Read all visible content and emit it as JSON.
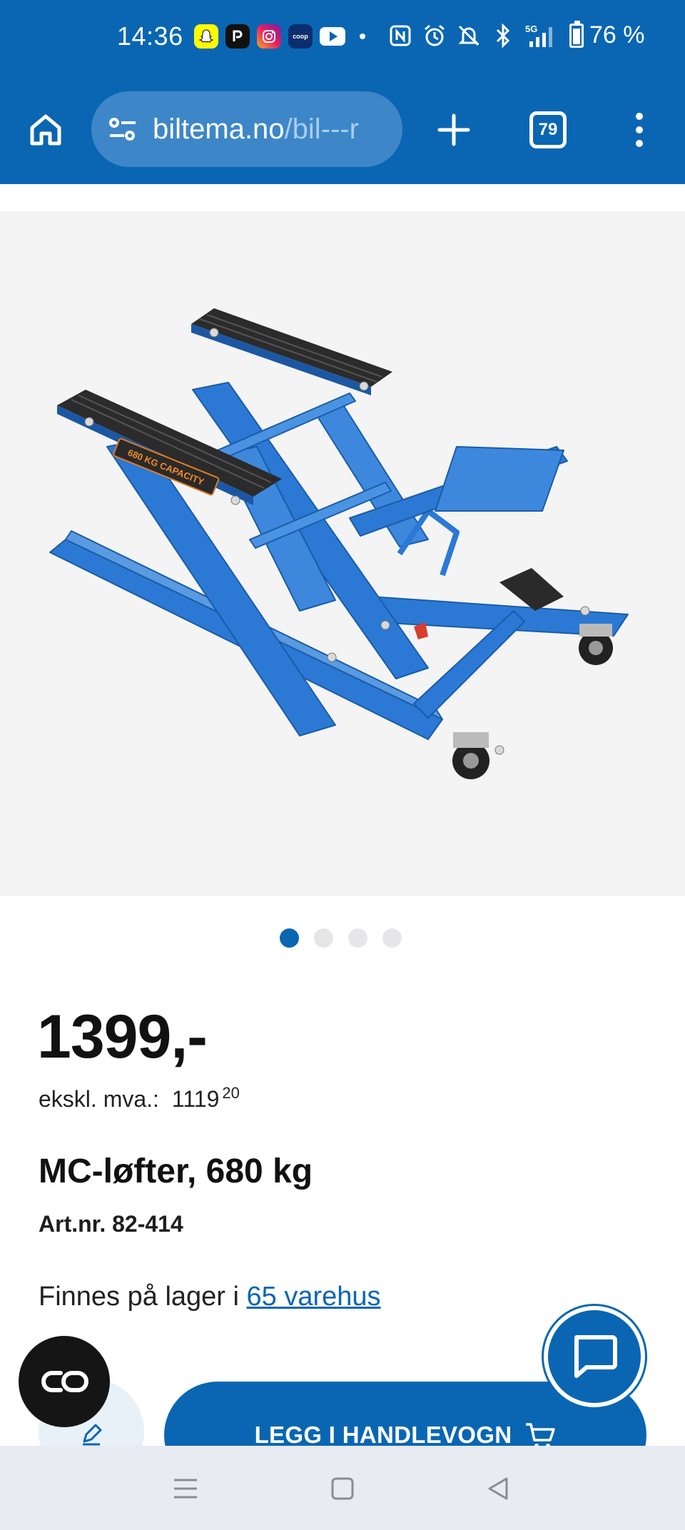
{
  "status_bar": {
    "time": "14:36",
    "network": "5G",
    "battery": "76 %",
    "battery_level": 0.76,
    "app_icons": [
      "snapchat-icon",
      "p-app-icon",
      "instagram-icon",
      "coop-icon",
      "youtube-icon"
    ],
    "coop_label": "coop",
    "system_icons": [
      "nfc-icon",
      "alarm-icon",
      "mute-icon",
      "bluetooth-icon",
      "signal-icon",
      "battery-icon"
    ]
  },
  "browser": {
    "url_host": "biltema.no",
    "url_path": "/bil---r",
    "tab_count": "79",
    "icons": [
      "home-icon",
      "tune-icon",
      "plus-icon",
      "tabs-icon",
      "more-vert-icon"
    ]
  },
  "gallery": {
    "image_label": "680 KG CAPACITY",
    "dot_count": 4,
    "active_index": 0
  },
  "product": {
    "price": "1399,-",
    "vat_label": "ekskl. mva.:",
    "vat_value": "1119",
    "vat_decimals": "20",
    "title": "MC-løfter, 680 kg",
    "art_nr": "Art.nr. 82-414",
    "stock_prefix": "Finnes på lager i ",
    "stock_link": "65 varehus"
  },
  "actions": {
    "add_to_cart": "LEGG I HANDLEVOGN",
    "chat_icon": "chat-bubble-icon",
    "cookie_icon": "cookie-toggle-icon",
    "edit_icon": "pencil-icon",
    "cart_icon": "shopping-cart-icon"
  },
  "colors": {
    "brand_blue": "#0a66b2",
    "lift_blue": "#2b79d4",
    "image_bg": "#f4f4f5"
  },
  "nav": {
    "icons": [
      "recents-icon",
      "home-nav-icon",
      "back-icon"
    ]
  }
}
